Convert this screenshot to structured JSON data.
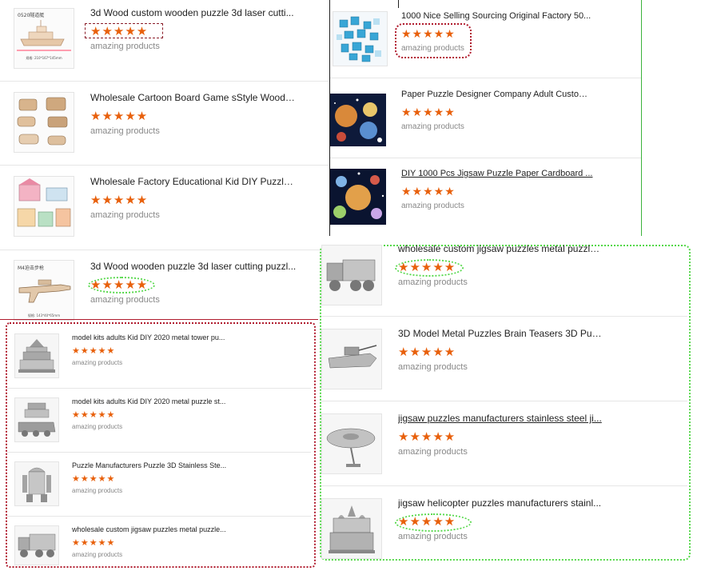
{
  "panel_a": {
    "items": [
      {
        "title": "3d Wood custom wooden puzzle 3d laser cutti...",
        "rating": "★★★★★",
        "subtitle": "amazing products",
        "thumb_text": "0520隧道艇"
      },
      {
        "title": "Wholesale Cartoon Board Game sStyle Woode...",
        "rating": "★★★★★",
        "subtitle": "amazing products"
      },
      {
        "title": "Wholesale Factory Educational Kid DIY Puzzle ...",
        "rating": "★★★★★",
        "subtitle": "amazing products"
      },
      {
        "title": "3d Wood wooden puzzle 3d laser cutting puzzl...",
        "rating": "★★★★★",
        "subtitle": "amazing products",
        "thumb_text": "M4迫击步枪"
      }
    ]
  },
  "panel_b": {
    "items": [
      {
        "title": "1000 Nice Selling Sourcing Original Factory 50...",
        "rating": "★★★★★",
        "subtitle": "amazing products"
      },
      {
        "title": "Paper Puzzle Designer Company Adult Custom...",
        "rating": "★★★★★",
        "subtitle": "amazing products"
      },
      {
        "title": "DIY 1000 Pcs Jigsaw Puzzle Paper Cardboard ...",
        "rating": "★★★★★",
        "subtitle": "amazing products"
      }
    ]
  },
  "panel_c": {
    "items": [
      {
        "title": "model kits adults Kid DIY 2020 metal tower pu...",
        "rating": "★★★★★",
        "subtitle": "amazing products"
      },
      {
        "title": "model kits adults Kid DIY 2020 metal puzzle st...",
        "rating": "★★★★★",
        "subtitle": "amazing products"
      },
      {
        "title": "Puzzle Manufacturers Puzzle 3D Stainless Ste...",
        "rating": "★★★★★",
        "subtitle": "amazing products"
      },
      {
        "title": "wholesale custom jigsaw puzzles metal puzzle...",
        "rating": "★★★★★",
        "subtitle": "amazing products"
      }
    ]
  },
  "panel_d": {
    "items": [
      {
        "title": "wholesale custom jigsaw puzzles metal puzzle...",
        "rating": "★★★★★",
        "subtitle": "amazing products"
      },
      {
        "title": "3D Model Metal Puzzles Brain Teasers 3D Puz...",
        "rating": "★★★★★",
        "subtitle": "amazing products"
      },
      {
        "title": "jigsaw puzzles manufacturers stainless steel ji...",
        "rating": "★★★★★",
        "subtitle": "amazing products"
      },
      {
        "title": "jigsaw helicopter puzzles manufacturers stainl...",
        "rating": "★★★★★",
        "subtitle": "amazing products"
      }
    ]
  },
  "colors": {
    "star": "#e8600c",
    "red_highlight": "#b01c2e",
    "green_highlight": "#55d84a",
    "divider": "#e6e6e6"
  }
}
